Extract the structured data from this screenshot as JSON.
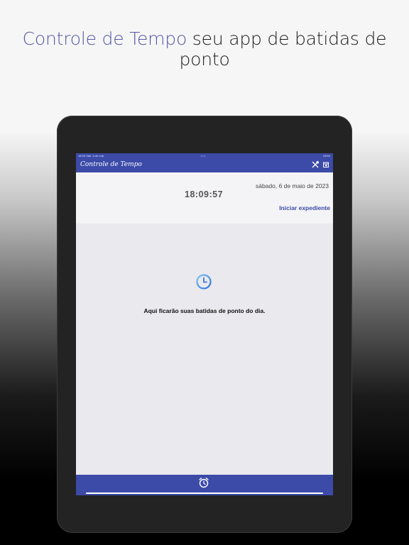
{
  "headline": {
    "accent": "Controle de Tempo",
    "rest": " seu app de batidas de ponto"
  },
  "statusbar": {
    "left": "18:09  Sáb. 6 de mai.",
    "center": "•••",
    "right": "100%"
  },
  "appbar": {
    "title": "Controle de Tempo",
    "icons": [
      "tools-icon",
      "calendar-export-icon"
    ]
  },
  "header": {
    "date": "sábado, 6 de maio de 2023",
    "time": "18:09:57",
    "start_button": "Iniciar expediente"
  },
  "empty_state": {
    "icon": "clock-icon",
    "message": "Aqui ficarão suas batidas de ponto do dia."
  },
  "bottombar": {
    "icon": "alarm-clock-icon"
  },
  "colors": {
    "accent": "#3c4aa8",
    "headline_accent": "#5757a6"
  }
}
